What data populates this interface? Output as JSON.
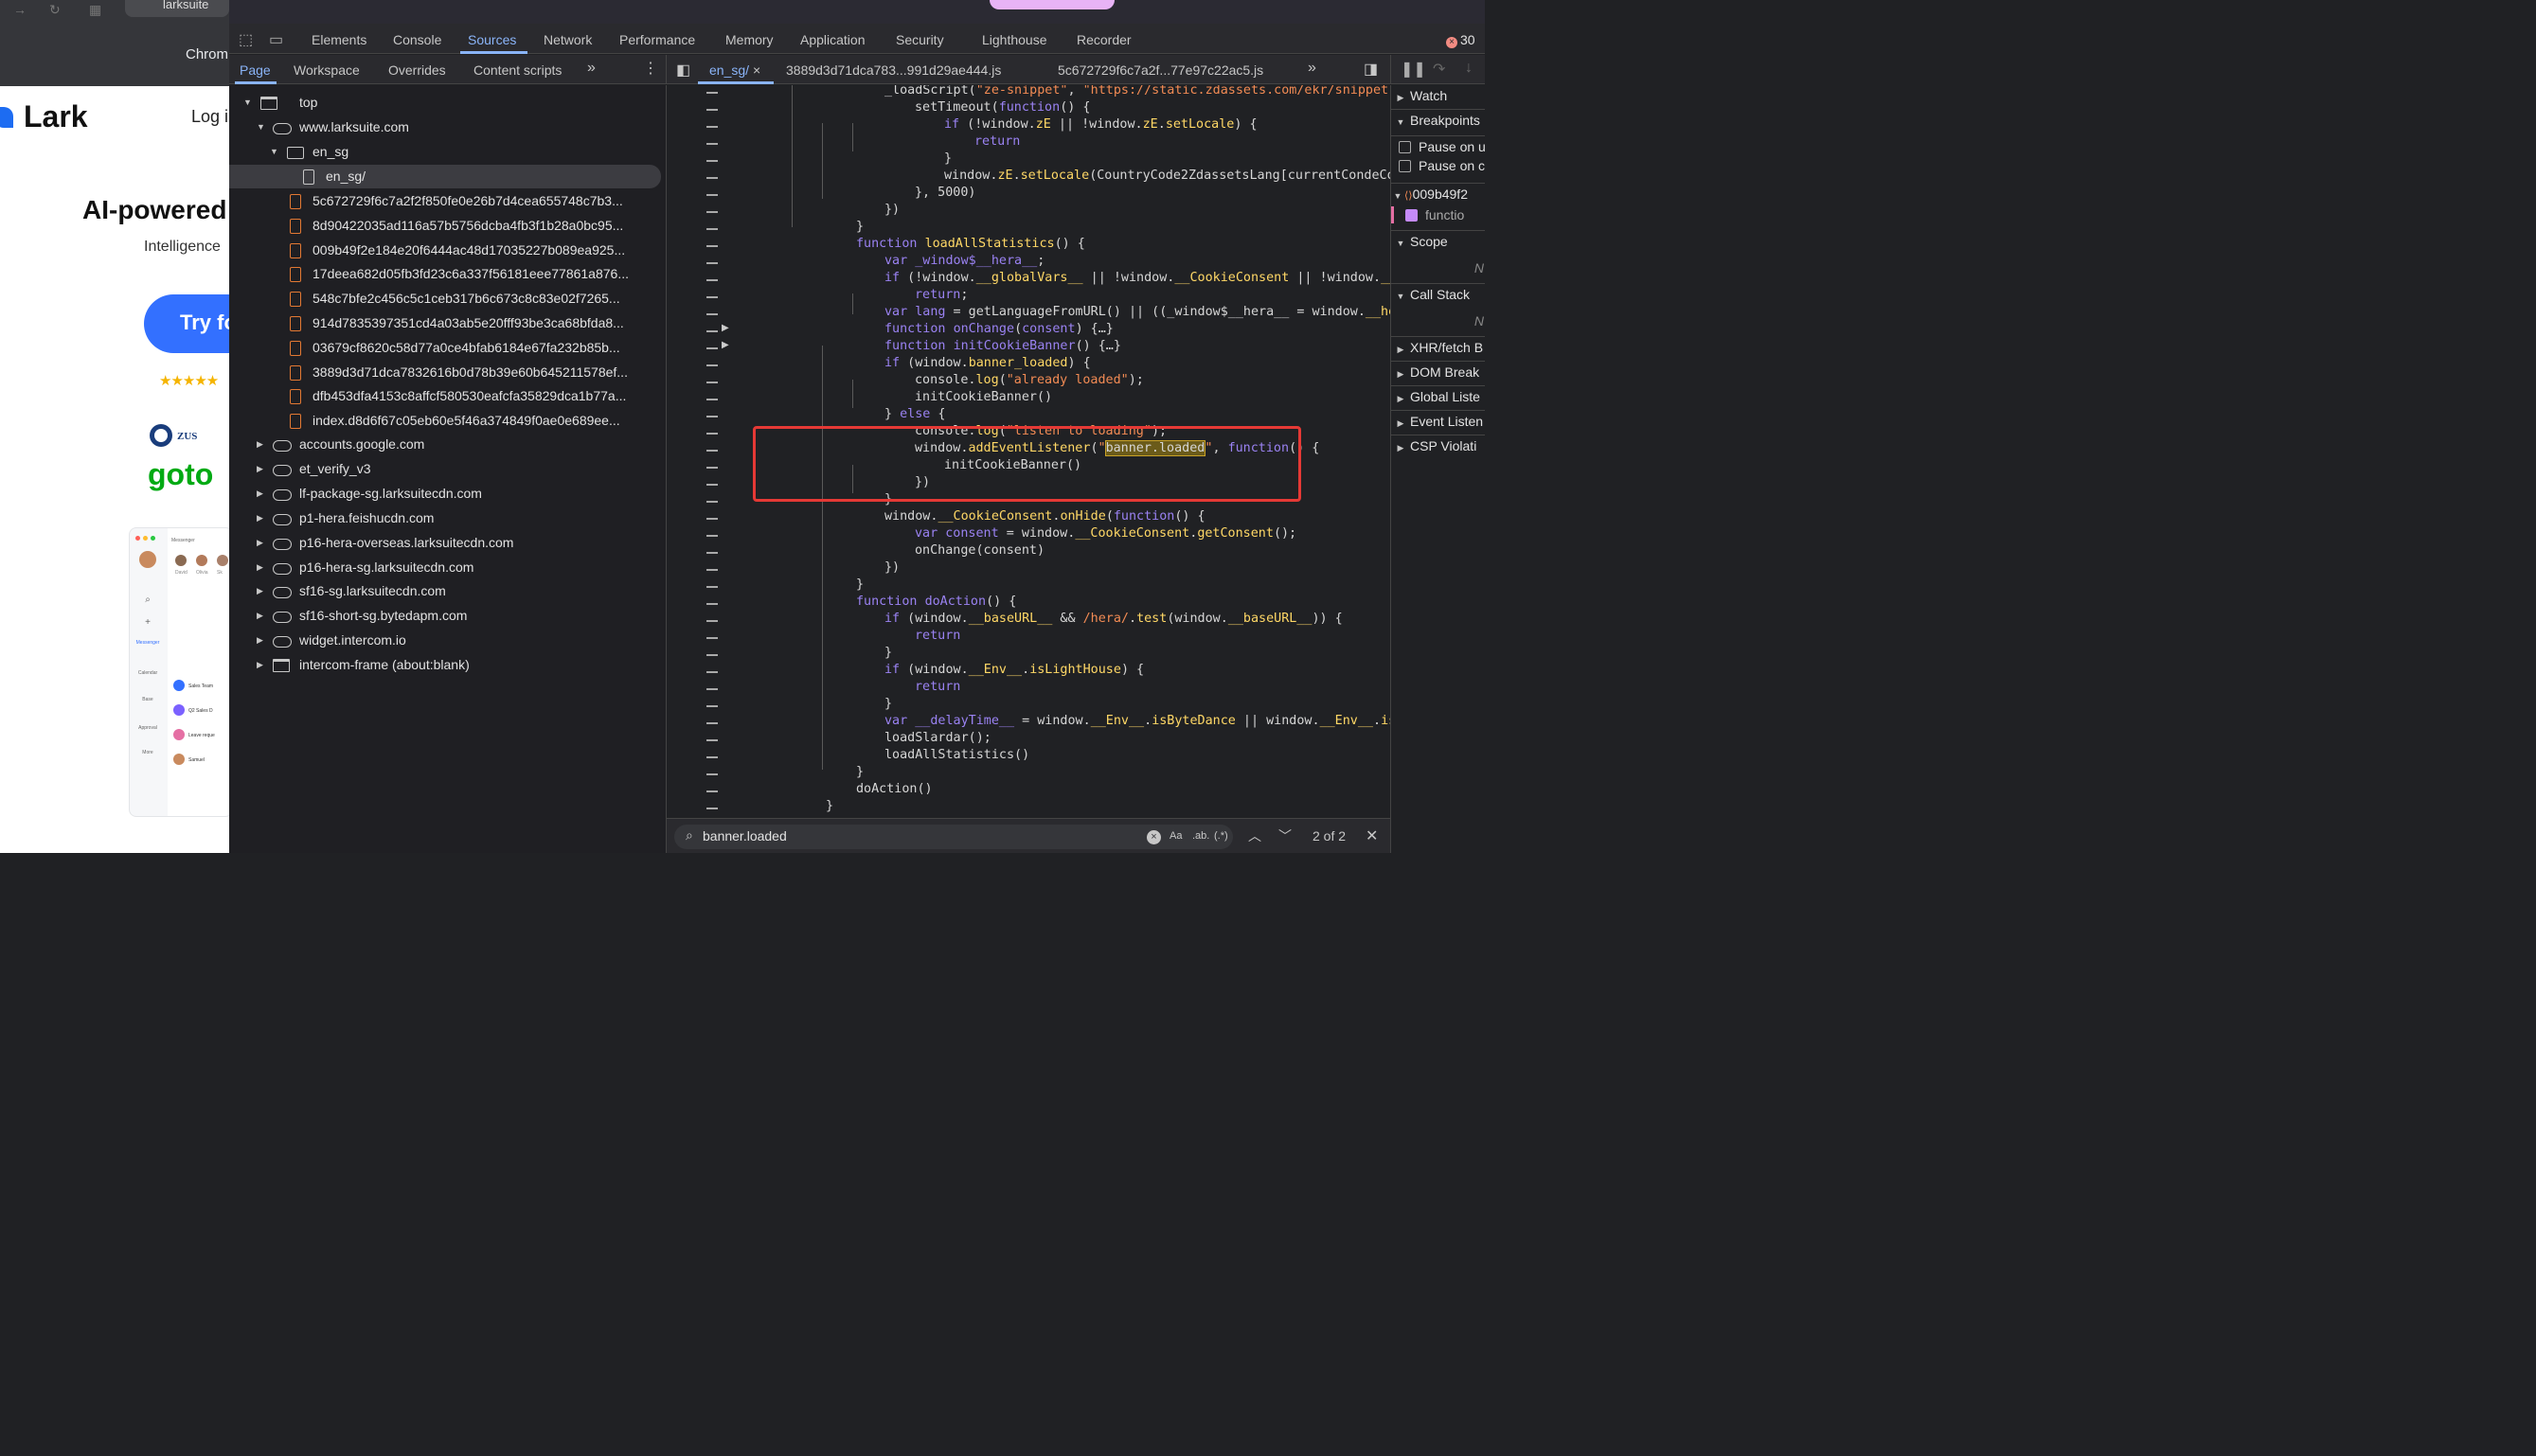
{
  "browser": {
    "tab_title": "larksuite",
    "chrome_label": "Chrom",
    "page": {
      "logo_text": "Lark",
      "login": "Log i",
      "hero_title": "AI-powered",
      "hero_subtitle": "Intelligence",
      "try_button": "Try fo",
      "stars": "★★★★★",
      "brand_zus": "ZUS",
      "brand_goto": "goto",
      "mock_app": {
        "title": "Messenger",
        "people": [
          "David",
          "Olivia",
          "Sk"
        ],
        "chats": [
          "Sales Team",
          "Q2 Sales D",
          "Leave reque",
          "Samuel"
        ],
        "sidebar": [
          "Messenger",
          "Calendar",
          "Base",
          "Approval",
          "More"
        ]
      }
    }
  },
  "devtools": {
    "tabs": [
      "Elements",
      "Console",
      "Sources",
      "Network",
      "Performance",
      "Memory",
      "Application",
      "Security",
      "Lighthouse",
      "Recorder"
    ],
    "active_tab": "Sources",
    "error_count": "30",
    "navigator_tabs": [
      "Page",
      "Workspace",
      "Overrides",
      "Content scripts"
    ],
    "tree": {
      "top": "top",
      "domain": "www.larksuite.com",
      "folder": "en_sg",
      "selected_file": "en_sg/",
      "files": [
        "5c672729f6c7a2f2f850fe0e26b7d4cea655748c7b3...",
        "8d90422035ad116a57b5756dcba4fb3f1b28a0bc95...",
        "009b49f2e184e20f6444ac48d17035227b089ea925...",
        "17deea682d05fb3fd23c6a337f56181eee77861a876...",
        "548c7bfe2c456c5c1ceb317b6c673c8c83e02f7265...",
        "914d7835397351cd4a03ab5e20fff93be3ca68bfda8...",
        "03679cf8620c58d77a0ce4bfab6184e67fa232b85b...",
        "3889d3d71dca7832616b0d78b39e60b645211578ef...",
        "dfb453dfa4153c8affcf580530eafcfa35829dca1b77a...",
        "index.d8d6f67c05eb60e5f46a374849f0ae0e689ee..."
      ],
      "hosts": [
        "accounts.google.com",
        "et_verify_v3",
        "lf-package-sg.larksuitecdn.com",
        "p1-hera.feishucdn.com",
        "p16-hera-overseas.larksuitecdn.com",
        "p16-hera-sg.larksuitecdn.com",
        "sf16-sg.larksuitecdn.com",
        "sf16-short-sg.bytedapm.com",
        "widget.intercom.io"
      ],
      "frame": "intercom-frame (about:blank)"
    },
    "editor_tabs": [
      "en_sg/",
      "3889d3d71dca783...991d29ae444.js",
      "5c672729f6c7a2f...77e97c22ac5.js"
    ],
    "search": {
      "query": "banner.loaded",
      "match_case": "Aa",
      "whole_word": ".ab.",
      "regex": "(.*)",
      "count": "2 of 2"
    },
    "debugger": {
      "watch": "Watch",
      "breakpoints": "Breakpoints",
      "pause_uncaught": "Pause on u",
      "pause_caught": "Pause on c",
      "bp_file": "009b49f2",
      "bp_line": "functio",
      "scope": "Scope",
      "scope_note": "N",
      "call_stack": "Call Stack",
      "callstack_note": "N",
      "xhr": "XHR/fetch B",
      "dom": "DOM Break",
      "global": "Global Liste",
      "event": "Event Listen",
      "csp": "CSP Violati"
    }
  }
}
